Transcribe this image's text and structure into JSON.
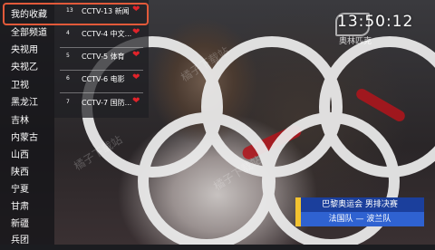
{
  "clock": {
    "time": "13:50:12"
  },
  "channel_logo": {
    "sub_text": "奥林匹克"
  },
  "watermark": "橘子下载站",
  "sidebar": {
    "categories": [
      {
        "label": "我的收藏",
        "selected": true
      },
      {
        "label": "全部频道"
      },
      {
        "label": "央视用"
      },
      {
        "label": "央视乙"
      },
      {
        "label": "卫视"
      },
      {
        "label": "黑龙江"
      },
      {
        "label": "吉林"
      },
      {
        "label": "内蒙古"
      },
      {
        "label": "山西"
      },
      {
        "label": "陕西"
      },
      {
        "label": "宁夏"
      },
      {
        "label": "甘肃"
      },
      {
        "label": "新疆"
      },
      {
        "label": "兵团"
      }
    ]
  },
  "channels": [
    {
      "number": "13",
      "name": "CCTV-13 新闻",
      "favorite": true
    },
    {
      "number": "4",
      "name": "CCTV-4 中文...",
      "favorite": true
    },
    {
      "number": "5",
      "name": "CCTV-5 体育",
      "favorite": true
    },
    {
      "number": "6",
      "name": "CCTV-6 电影",
      "favorite": true
    },
    {
      "number": "7",
      "name": "CCTV-7 国防...",
      "favorite": true
    }
  ],
  "caption": {
    "title": "巴黎奥运会  男排决赛",
    "teams": "法国队 — 波兰队"
  },
  "colors": {
    "accent_frame": "#e25a3a",
    "heart": "#e2232a",
    "caption_dark": "#1b3f9c",
    "caption_light": "#2f62d1"
  }
}
